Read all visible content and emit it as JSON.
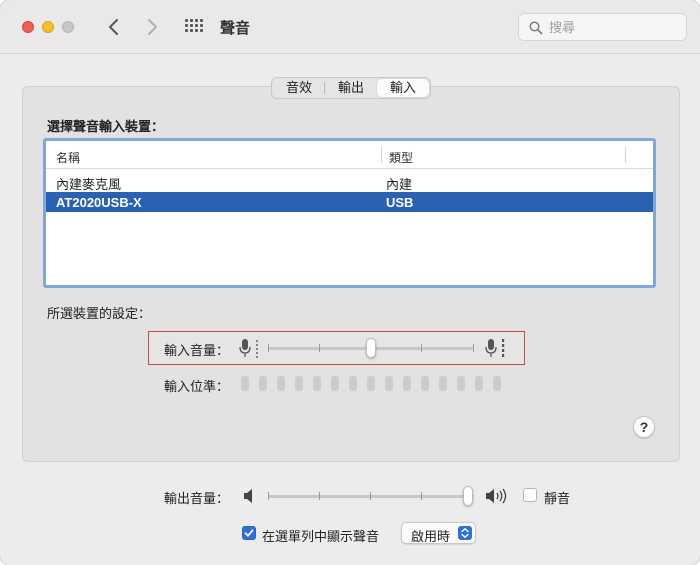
{
  "window": {
    "title": "聲音"
  },
  "search": {
    "placeholder": "搜尋"
  },
  "tabs": [
    {
      "label": "音效",
      "active": false
    },
    {
      "label": "輸出",
      "active": false
    },
    {
      "label": "輸入",
      "active": true
    }
  ],
  "input": {
    "section_title": "選擇聲音輸入裝置：",
    "table": {
      "columns": [
        "名稱",
        "類型"
      ],
      "rows": [
        {
          "name": "內建麥克風",
          "type": "內建",
          "selected": false
        },
        {
          "name": "AT2020USB-X",
          "type": "USB",
          "selected": true
        }
      ]
    },
    "settings_label": "所選裝置的設定：",
    "volume": {
      "label": "輸入音量：",
      "level": 0.5
    },
    "level_meter": {
      "label": "輸入位準：",
      "segments": 15,
      "lit": 0
    }
  },
  "output": {
    "volume": {
      "label": "輸出音量：",
      "level": 1.0
    },
    "mute": {
      "label": "靜音",
      "checked": false
    }
  },
  "menubar": {
    "show_label": "在選單列中顯示聲音",
    "checked": true,
    "option": "啟用時"
  },
  "help": {
    "label": "?"
  },
  "colors": {
    "selection": "#2a62b1",
    "accent": "#2f6fd6",
    "highlight_box": "#c94a4a"
  }
}
